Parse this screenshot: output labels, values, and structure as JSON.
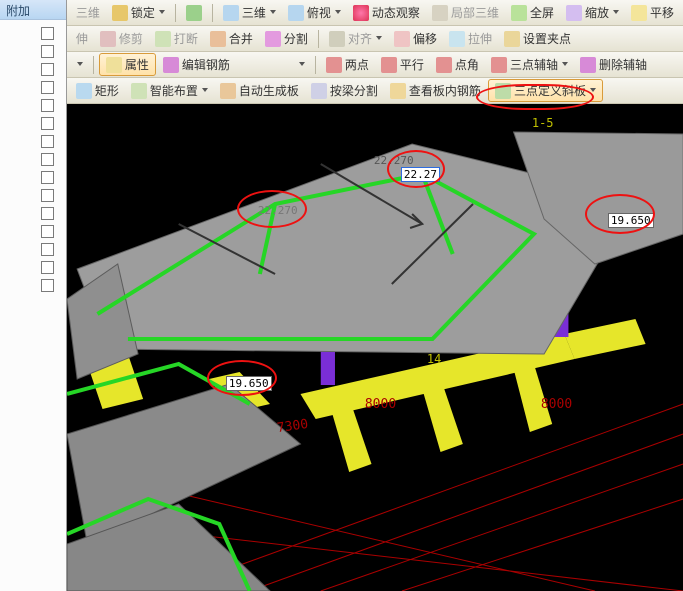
{
  "left": {
    "header": "附加"
  },
  "toolbar1": {
    "t1": "三维",
    "t2": "锁定",
    "t3": "三维",
    "t4": "俯视",
    "t5": "动态观察",
    "t6": "局部三维",
    "t7": "全屏",
    "t8": "缩放",
    "t9": "平移"
  },
  "toolbar2": {
    "t1": "伸",
    "t2": "修剪",
    "t3": "打断",
    "t4": "合并",
    "t5": "分割",
    "t6": "对齐",
    "t7": "偏移",
    "t8": "拉伸",
    "t9": "设置夹点"
  },
  "toolbar3": {
    "t1": "属性",
    "t2": "编辑钢筋",
    "t3": "两点",
    "t4": "平行",
    "t5": "点角",
    "t6": "三点辅轴",
    "t7": "删除辅轴"
  },
  "toolbar4": {
    "t1": "矩形",
    "t2": "智能布置",
    "t3": "自动生成板",
    "t4": "按梁分割",
    "t5": "查看板内钢筋",
    "t6": "三点定义斜板"
  },
  "viewport": {
    "edit_value": "22.27",
    "labels": {
      "l1": "22.270",
      "l2": "22.270",
      "l3": "19.650",
      "l4": "19.650"
    },
    "dims": {
      "d1": "8000",
      "d2": "8000",
      "d3": "7300"
    },
    "grids": {
      "g1": "1-5",
      "g2": "14"
    }
  }
}
